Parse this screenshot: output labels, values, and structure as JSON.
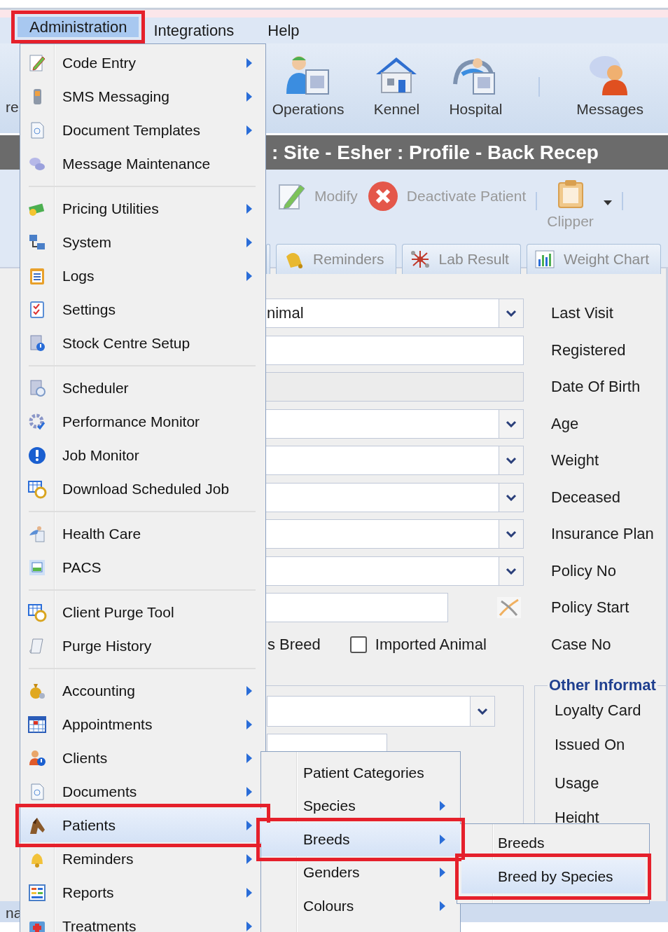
{
  "menubar": [
    {
      "label": "Administration",
      "selected": true,
      "highlighted": true
    },
    {
      "label": "Integrations",
      "selected": false,
      "highlighted": false
    },
    {
      "label": "Help",
      "selected": false,
      "highlighted": false
    }
  ],
  "toolbar": {
    "cut_label": "re",
    "buttons": [
      {
        "label": "Operations",
        "kind": "operations"
      },
      {
        "label": "Kennel",
        "kind": "kennel"
      },
      {
        "label": "Hospital",
        "kind": "hospital"
      },
      {
        "label": "Messages",
        "kind": "messages"
      }
    ]
  },
  "title_bar": ": Site - Esher : Profile - Back Recep",
  "actions": [
    {
      "label": "Modify",
      "kind": "modify"
    },
    {
      "label": "Deactivate Patient",
      "kind": "deactivate"
    },
    {
      "label": "Clipper",
      "kind": "clipper"
    }
  ],
  "tabs": [
    {
      "label": "Reminders",
      "kind": "bell"
    },
    {
      "label": "Lab Result",
      "kind": "lab"
    },
    {
      "label": "Weight Chart",
      "kind": "chart"
    }
  ],
  "form": {
    "rows": [
      {
        "kind": "combo",
        "value": "nimal",
        "label": "Last Visit"
      },
      {
        "kind": "text",
        "label": "Registered"
      },
      {
        "kind": "readonly",
        "label": "Date Of Birth"
      },
      {
        "kind": "combo",
        "label": "Age"
      },
      {
        "kind": "combo",
        "label": "Weight"
      },
      {
        "kind": "combo",
        "label": "Deceased"
      },
      {
        "kind": "combo",
        "label": "Insurance Plan"
      },
      {
        "kind": "combo",
        "label": "Policy No"
      },
      {
        "kind": "clearable",
        "label": "Policy Start"
      },
      {
        "kind": "checkbox",
        "left_text": "s Breed",
        "checkbox_label": "Imported Animal",
        "checked": false,
        "label": "Case No"
      }
    ]
  },
  "other_information": {
    "legend": "Other Informat",
    "labels": [
      "Loyalty Card",
      "Issued On",
      "Usage",
      "Height"
    ]
  },
  "status_bar": {
    "cut_label": "na"
  },
  "admin_menu": {
    "items": [
      {
        "kind": "item",
        "label": "Code Entry",
        "submenu": true,
        "selected": false,
        "highlighted": false
      },
      {
        "kind": "item",
        "label": "SMS Messaging",
        "submenu": true,
        "selected": false,
        "highlighted": false
      },
      {
        "kind": "item",
        "label": "Document Templates",
        "submenu": true,
        "selected": false,
        "highlighted": false
      },
      {
        "kind": "item",
        "label": "Message Maintenance",
        "submenu": false,
        "selected": false,
        "highlighted": false
      },
      {
        "kind": "separator"
      },
      {
        "kind": "item",
        "label": "Pricing Utilities",
        "submenu": true,
        "selected": false,
        "highlighted": false
      },
      {
        "kind": "item",
        "label": "System",
        "submenu": true,
        "selected": false,
        "highlighted": false
      },
      {
        "kind": "item",
        "label": "Logs",
        "submenu": true,
        "selected": false,
        "highlighted": false
      },
      {
        "kind": "item",
        "label": "Settings",
        "submenu": false,
        "selected": false,
        "highlighted": false
      },
      {
        "kind": "item",
        "label": "Stock Centre Setup",
        "submenu": false,
        "selected": false,
        "highlighted": false
      },
      {
        "kind": "separator"
      },
      {
        "kind": "item",
        "label": "Scheduler",
        "submenu": false,
        "selected": false,
        "highlighted": false
      },
      {
        "kind": "item",
        "label": "Performance Monitor",
        "submenu": false,
        "selected": false,
        "highlighted": false
      },
      {
        "kind": "item",
        "label": "Job Monitor",
        "submenu": false,
        "selected": false,
        "highlighted": false
      },
      {
        "kind": "item",
        "label": "Download Scheduled Job",
        "submenu": false,
        "selected": false,
        "highlighted": false
      },
      {
        "kind": "separator"
      },
      {
        "kind": "item",
        "label": "Health Care",
        "submenu": false,
        "selected": false,
        "highlighted": false
      },
      {
        "kind": "item",
        "label": "PACS",
        "submenu": false,
        "selected": false,
        "highlighted": false
      },
      {
        "kind": "separator"
      },
      {
        "kind": "item",
        "label": "Client Purge Tool",
        "submenu": false,
        "selected": false,
        "highlighted": false
      },
      {
        "kind": "item",
        "label": "Purge History",
        "submenu": false,
        "selected": false,
        "highlighted": false
      },
      {
        "kind": "separator"
      },
      {
        "kind": "item",
        "label": "Accounting",
        "submenu": true,
        "selected": false,
        "highlighted": false
      },
      {
        "kind": "item",
        "label": "Appointments",
        "submenu": true,
        "selected": false,
        "highlighted": false
      },
      {
        "kind": "item",
        "label": "Clients",
        "submenu": true,
        "selected": false,
        "highlighted": false
      },
      {
        "kind": "item",
        "label": "Documents",
        "submenu": true,
        "selected": false,
        "highlighted": false
      },
      {
        "kind": "item",
        "label": "Patients",
        "submenu": true,
        "selected": true,
        "highlighted": true
      },
      {
        "kind": "item",
        "label": "Reminders",
        "submenu": true,
        "selected": false,
        "highlighted": false
      },
      {
        "kind": "item",
        "label": "Reports",
        "submenu": true,
        "selected": false,
        "highlighted": false
      },
      {
        "kind": "item",
        "label": "Treatments",
        "submenu": true,
        "selected": false,
        "highlighted": false
      }
    ]
  },
  "patients_submenu": {
    "items": [
      {
        "label": "Patient Categories",
        "submenu": false,
        "selected": false,
        "highlighted": false
      },
      {
        "label": "Species",
        "submenu": true,
        "selected": false,
        "highlighted": false
      },
      {
        "label": "Breeds",
        "submenu": true,
        "selected": true,
        "highlighted": true
      },
      {
        "label": "Genders",
        "submenu": true,
        "selected": false,
        "highlighted": false
      },
      {
        "label": "Colours",
        "submenu": true,
        "selected": false,
        "highlighted": false
      }
    ]
  },
  "breeds_submenu": {
    "items": [
      {
        "label": "Breeds",
        "submenu": false,
        "selected": false,
        "highlighted": false
      },
      {
        "label": "Breed by Species",
        "submenu": false,
        "selected": true,
        "highlighted": true
      }
    ]
  }
}
